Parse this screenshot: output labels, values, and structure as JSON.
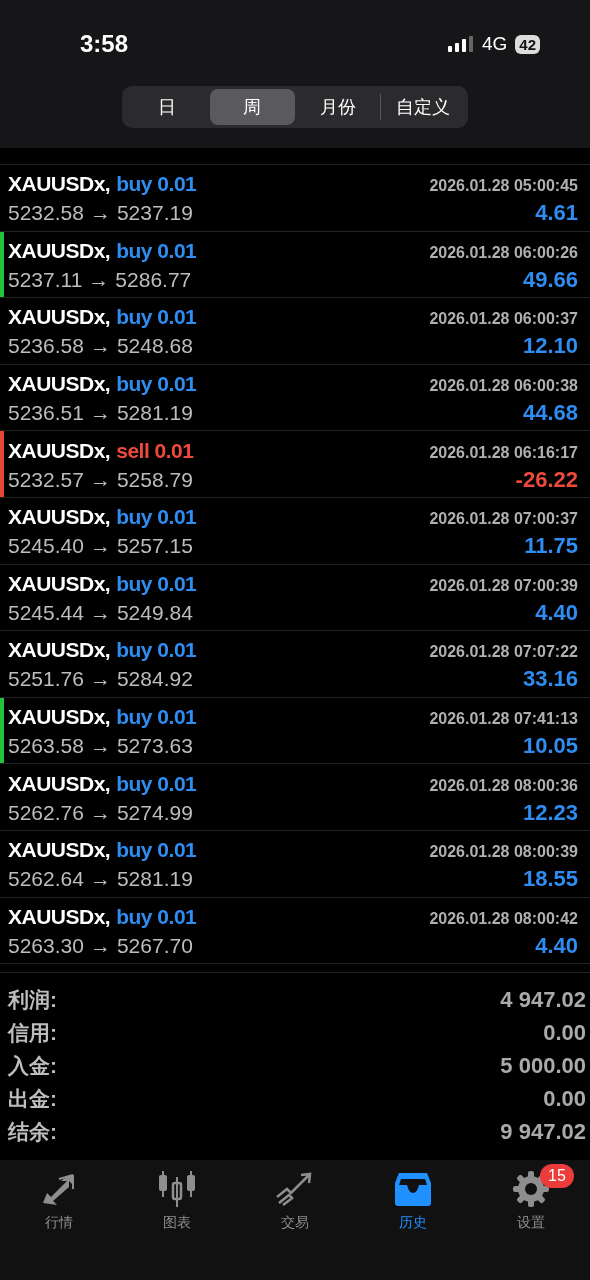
{
  "status_bar": {
    "time": "3:58",
    "network": "4G",
    "battery": "42"
  },
  "period_tabs": [
    {
      "label": "日",
      "selected": false
    },
    {
      "label": "周",
      "selected": true
    },
    {
      "label": "月份",
      "selected": false
    },
    {
      "label": "自定义",
      "selected": false
    }
  ],
  "trades": [
    {
      "symbol": "XAUUSDx,",
      "kind": "buy",
      "order": "buy 0.01",
      "time": "2026.01.28 05:00:45",
      "open": "5232.58",
      "arrow": "→",
      "close": "5237.19",
      "profit": "4.61"
    },
    {
      "symbol": "XAUUSDx,",
      "kind": "buy",
      "order": "buy 0.01",
      "time": "2026.01.28 06:00:26",
      "open": "5237.11",
      "arrow": "→",
      "close": "5286.77",
      "profit": "49.66",
      "color": "#22c23c"
    },
    {
      "symbol": "XAUUSDx,",
      "kind": "buy",
      "order": "buy 0.01",
      "time": "2026.01.28 06:00:37",
      "open": "5236.58",
      "arrow": "→",
      "close": "5248.68",
      "profit": "12.10"
    },
    {
      "symbol": "XAUUSDx,",
      "kind": "buy",
      "order": "buy 0.01",
      "time": "2026.01.28 06:00:38",
      "open": "5236.51",
      "arrow": "→",
      "close": "5281.19",
      "profit": "44.68"
    },
    {
      "symbol": "XAUUSDx,",
      "kind": "sell",
      "order": "sell 0.01",
      "time": "2026.01.28 06:16:17",
      "open": "5232.57",
      "arrow": "→",
      "close": "5258.79",
      "profit": "-26.22",
      "color": "#e5483b"
    },
    {
      "symbol": "XAUUSDx,",
      "kind": "buy",
      "order": "buy 0.01",
      "time": "2026.01.28 07:00:37",
      "open": "5245.40",
      "arrow": "→",
      "close": "5257.15",
      "profit": "11.75"
    },
    {
      "symbol": "XAUUSDx,",
      "kind": "buy",
      "order": "buy 0.01",
      "time": "2026.01.28 07:00:39",
      "open": "5245.44",
      "arrow": "→",
      "close": "5249.84",
      "profit": "4.40"
    },
    {
      "symbol": "XAUUSDx,",
      "kind": "buy",
      "order": "buy 0.01",
      "time": "2026.01.28 07:07:22",
      "open": "5251.76",
      "arrow": "→",
      "close": "5284.92",
      "profit": "33.16"
    },
    {
      "symbol": "XAUUSDx,",
      "kind": "buy",
      "order": "buy 0.01",
      "time": "2026.01.28 07:41:13",
      "open": "5263.58",
      "arrow": "→",
      "close": "5273.63",
      "profit": "10.05",
      "color": "#22c23c"
    },
    {
      "symbol": "XAUUSDx,",
      "kind": "buy",
      "order": "buy 0.01",
      "time": "2026.01.28 08:00:36",
      "open": "5262.76",
      "arrow": "→",
      "close": "5274.99",
      "profit": "12.23"
    },
    {
      "symbol": "XAUUSDx,",
      "kind": "buy",
      "order": "buy 0.01",
      "time": "2026.01.28 08:00:39",
      "open": "5262.64",
      "arrow": "→",
      "close": "5281.19",
      "profit": "18.55"
    },
    {
      "symbol": "XAUUSDx,",
      "kind": "buy",
      "order": "buy 0.01",
      "time": "2026.01.28 08:00:42",
      "open": "5263.30",
      "arrow": "→",
      "close": "5267.70",
      "profit": "4.40"
    }
  ],
  "summary": [
    {
      "label": "利润:",
      "value": "4 947.02"
    },
    {
      "label": "信用:",
      "value": "0.00"
    },
    {
      "label": "入金:",
      "value": "5 000.00"
    },
    {
      "label": "出金:",
      "value": "0.00"
    },
    {
      "label": "结余:",
      "value": "9 947.02"
    }
  ],
  "tab_bar": [
    {
      "kind": "quotes",
      "label": "行情",
      "selected": false
    },
    {
      "kind": "chart",
      "label": "图表",
      "selected": false
    },
    {
      "kind": "trade",
      "label": "交易",
      "selected": false
    },
    {
      "kind": "history",
      "label": "历史",
      "selected": true
    },
    {
      "kind": "settings",
      "label": "设置",
      "selected": false,
      "badge": "15"
    }
  ]
}
